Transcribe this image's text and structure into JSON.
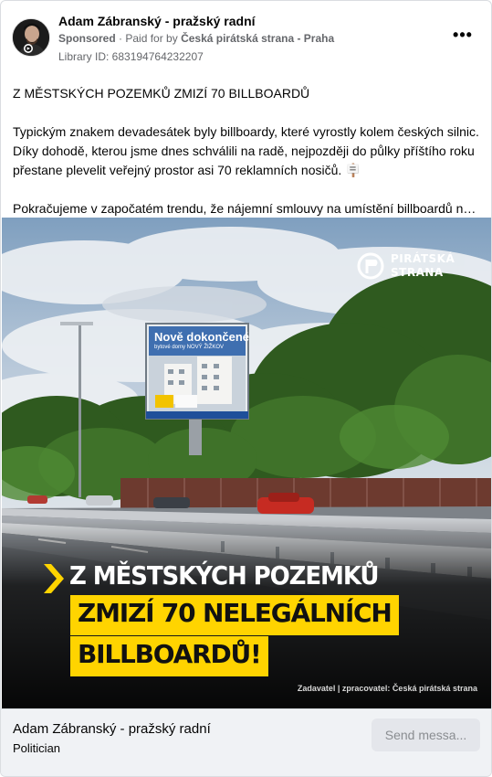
{
  "post": {
    "page_name": "Adam Zábranský - pražský radní",
    "sponsored_label": "Sponsored",
    "paid_for": "· Paid for by",
    "payer": "Česká pirátská strana - Praha",
    "library_id": "Library ID: 683194764232207",
    "more_label": "•••",
    "headline": "Z MĚSTSKÝCH POZEMKŮ ZMIZÍ 70 BILLBOARDŮ",
    "paragraph_1": "Typickým znakem devadesátek byly billboardy, které vyrostly kolem českých silnic. Díky dohodě, kterou jsme dnes schválili na radě, nejpozději do půlky příštího roku přestane plevelit veřejný prostor asi 70 reklamních nosičů. 🪧",
    "paragraph_2": "Pokračujeme v započatém trendu, že nájemní smlouvy na umístění billboardů na…"
  },
  "image": {
    "logo_line1": "PIRÁTSKÁ",
    "logo_line2": "STRANA",
    "billboard_title": "Nově dokončené",
    "billboard_sub": "bytové domy NOVÝ ŽIŽKOV",
    "overlay_line1": "Z MĚSTSKÝCH POZEMKŮ",
    "overlay_line2": "ZMIZÍ 70 NELEGÁLNÍCH",
    "overlay_line3": "BILLBOARDŮ!",
    "credit": "Zadavatel | zpracovatel: Česká pirátská strana",
    "colors": {
      "accent_yellow": "#ffd400",
      "overlay_dark": "#111111"
    }
  },
  "footer": {
    "name": "Adam Zábranský - pražský radní",
    "category": "Politician",
    "send_button": "Send messa..."
  }
}
